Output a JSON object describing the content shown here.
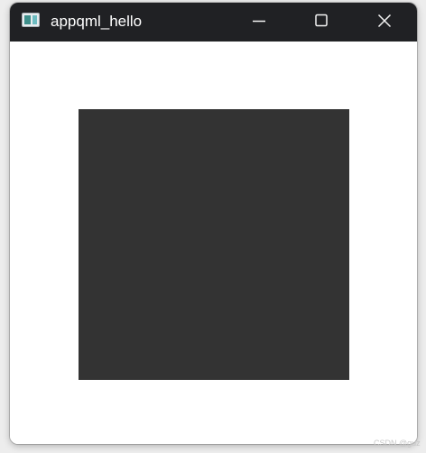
{
  "window": {
    "title": "appqml_hello",
    "icons": {
      "app": "app-icon",
      "minimize": "minimize-icon",
      "maximize": "maximize-icon",
      "close": "close-icon"
    }
  },
  "content": {
    "rectangle_color": "#333333"
  },
  "colors": {
    "titlebar": "#202124",
    "title_text": "#ffffff",
    "content_background": "#ffffff",
    "page_background": "#ededed"
  },
  "watermark": {
    "text": "CSDN @guz"
  }
}
